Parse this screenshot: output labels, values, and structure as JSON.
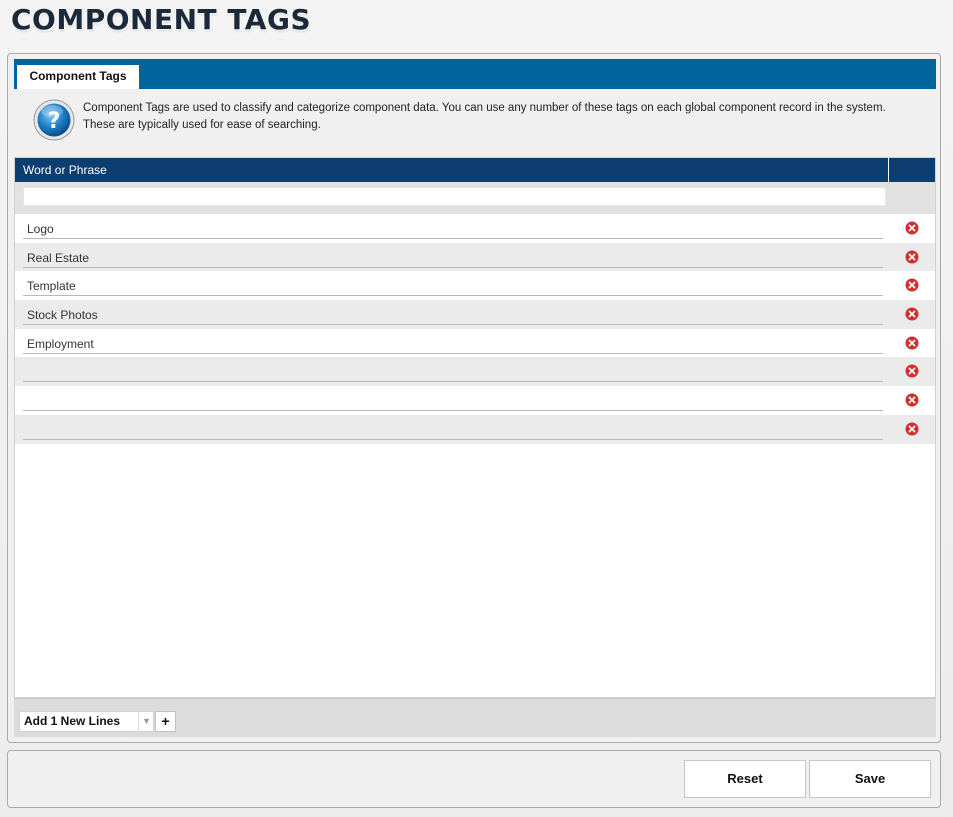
{
  "page": {
    "title": "COMPONENT TAGS"
  },
  "tab": {
    "label": "Component Tags"
  },
  "help": {
    "line1": "Component Tags are used to classify and categorize component data. You can use any number of these tags on each global component record in the system.",
    "line2": "These are typically used for ease of searching."
  },
  "grid": {
    "column_header": "Word or Phrase",
    "new_value": "",
    "rows": [
      {
        "value": "Logo"
      },
      {
        "value": "Real Estate"
      },
      {
        "value": "Template"
      },
      {
        "value": "Stock Photos"
      },
      {
        "value": "Employment"
      },
      {
        "value": ""
      },
      {
        "value": ""
      },
      {
        "value": ""
      }
    ]
  },
  "footer": {
    "lines_select_value": "Add 1 New Lines",
    "add_label": "+"
  },
  "actions": {
    "reset_label": "Reset",
    "save_label": "Save"
  },
  "colors": {
    "tab_strip": "#00659c",
    "header": "#0c3f70",
    "delete_red": "#d32f2f"
  },
  "icons": {
    "help": "question-mark-icon",
    "delete": "delete-x-icon",
    "dropdown": "chevron-down-icon"
  }
}
